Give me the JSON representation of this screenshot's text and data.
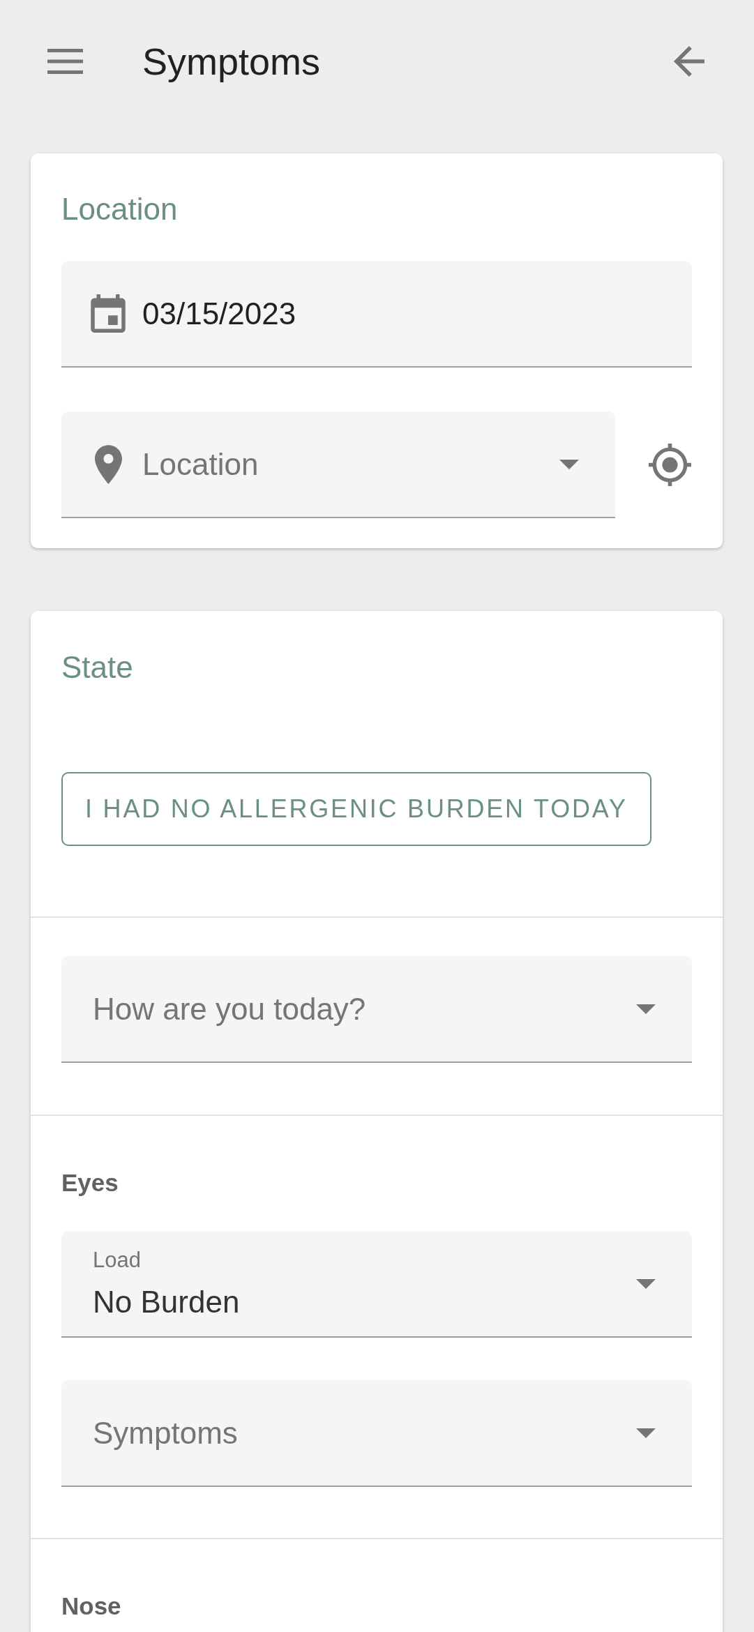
{
  "app_bar": {
    "title": "Symptoms"
  },
  "location_card": {
    "title": "Location",
    "date_field": {
      "value": "03/15/2023"
    },
    "location_field": {
      "placeholder": "Location"
    }
  },
  "state_card": {
    "title": "State",
    "no_burden_button": {
      "label": "I HAD NO ALLERGENIC BURDEN TODAY"
    },
    "mood_field": {
      "placeholder": "How are you today?"
    },
    "sections": [
      {
        "title": "Eyes",
        "fields": [
          {
            "label": "Load",
            "value": "No Burden"
          },
          {
            "placeholder": "Symptoms"
          }
        ]
      },
      {
        "title": "Nose"
      }
    ]
  }
}
